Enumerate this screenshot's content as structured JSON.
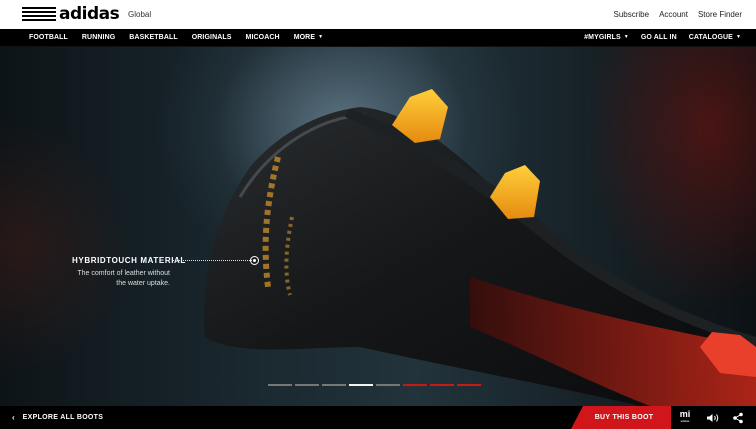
{
  "header": {
    "brand": "adidas",
    "region": "Global",
    "links": [
      "Subscribe",
      "Account",
      "Store Finder"
    ]
  },
  "nav": {
    "left": [
      {
        "label": "FOOTBALL"
      },
      {
        "label": "RUNNING"
      },
      {
        "label": "BASKETBALL"
      },
      {
        "label": "ORIGINALS"
      },
      {
        "label": "MICOACH"
      },
      {
        "label": "MORE",
        "dropdown": true
      }
    ],
    "right": [
      {
        "label": "#MYGIRLS",
        "dropdown": true
      },
      {
        "label": "GO ALL IN"
      },
      {
        "label": "CATALOGUE",
        "dropdown": true
      }
    ]
  },
  "hero": {
    "callout_title": "HYBRIDTOUCH MATERIAL",
    "callout_desc_line1": "The comfort of leather without",
    "callout_desc_line2": "the water uptake.",
    "slides": {
      "total": 8,
      "active_index": 3,
      "red_from_index": 5
    }
  },
  "footer": {
    "explore_label": "EXPLORE ALL BOOTS",
    "buy_label": "BUY THIS BOOT",
    "mi_logo": "mi",
    "mi_logo_sub": "adidas",
    "icons": [
      "chevron-left-icon",
      "speaker-icon",
      "share-icon"
    ]
  },
  "colors": {
    "accent_red": "#d0161b",
    "stud_orange": "#f5a623",
    "background": "#000000"
  }
}
